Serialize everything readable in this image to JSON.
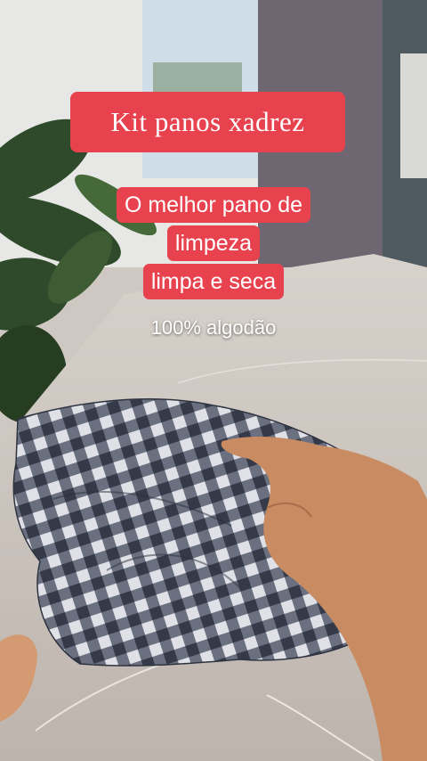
{
  "captions": {
    "title": "Kit panos xadrez",
    "subtitle_lines": [
      "O melhor pano de",
      "limpeza",
      "limpa e seca"
    ],
    "material": "100% algodão"
  },
  "colors": {
    "caption_background": "#e8424f",
    "caption_text": "#ffffff",
    "countertop": "#c9c1bb",
    "cloth_dark": "#3a4050",
    "cloth_light": "#dfe1e6"
  },
  "scene": {
    "description_icons": [
      "plant",
      "window",
      "countertop",
      "checkered-cloth",
      "hand"
    ]
  }
}
